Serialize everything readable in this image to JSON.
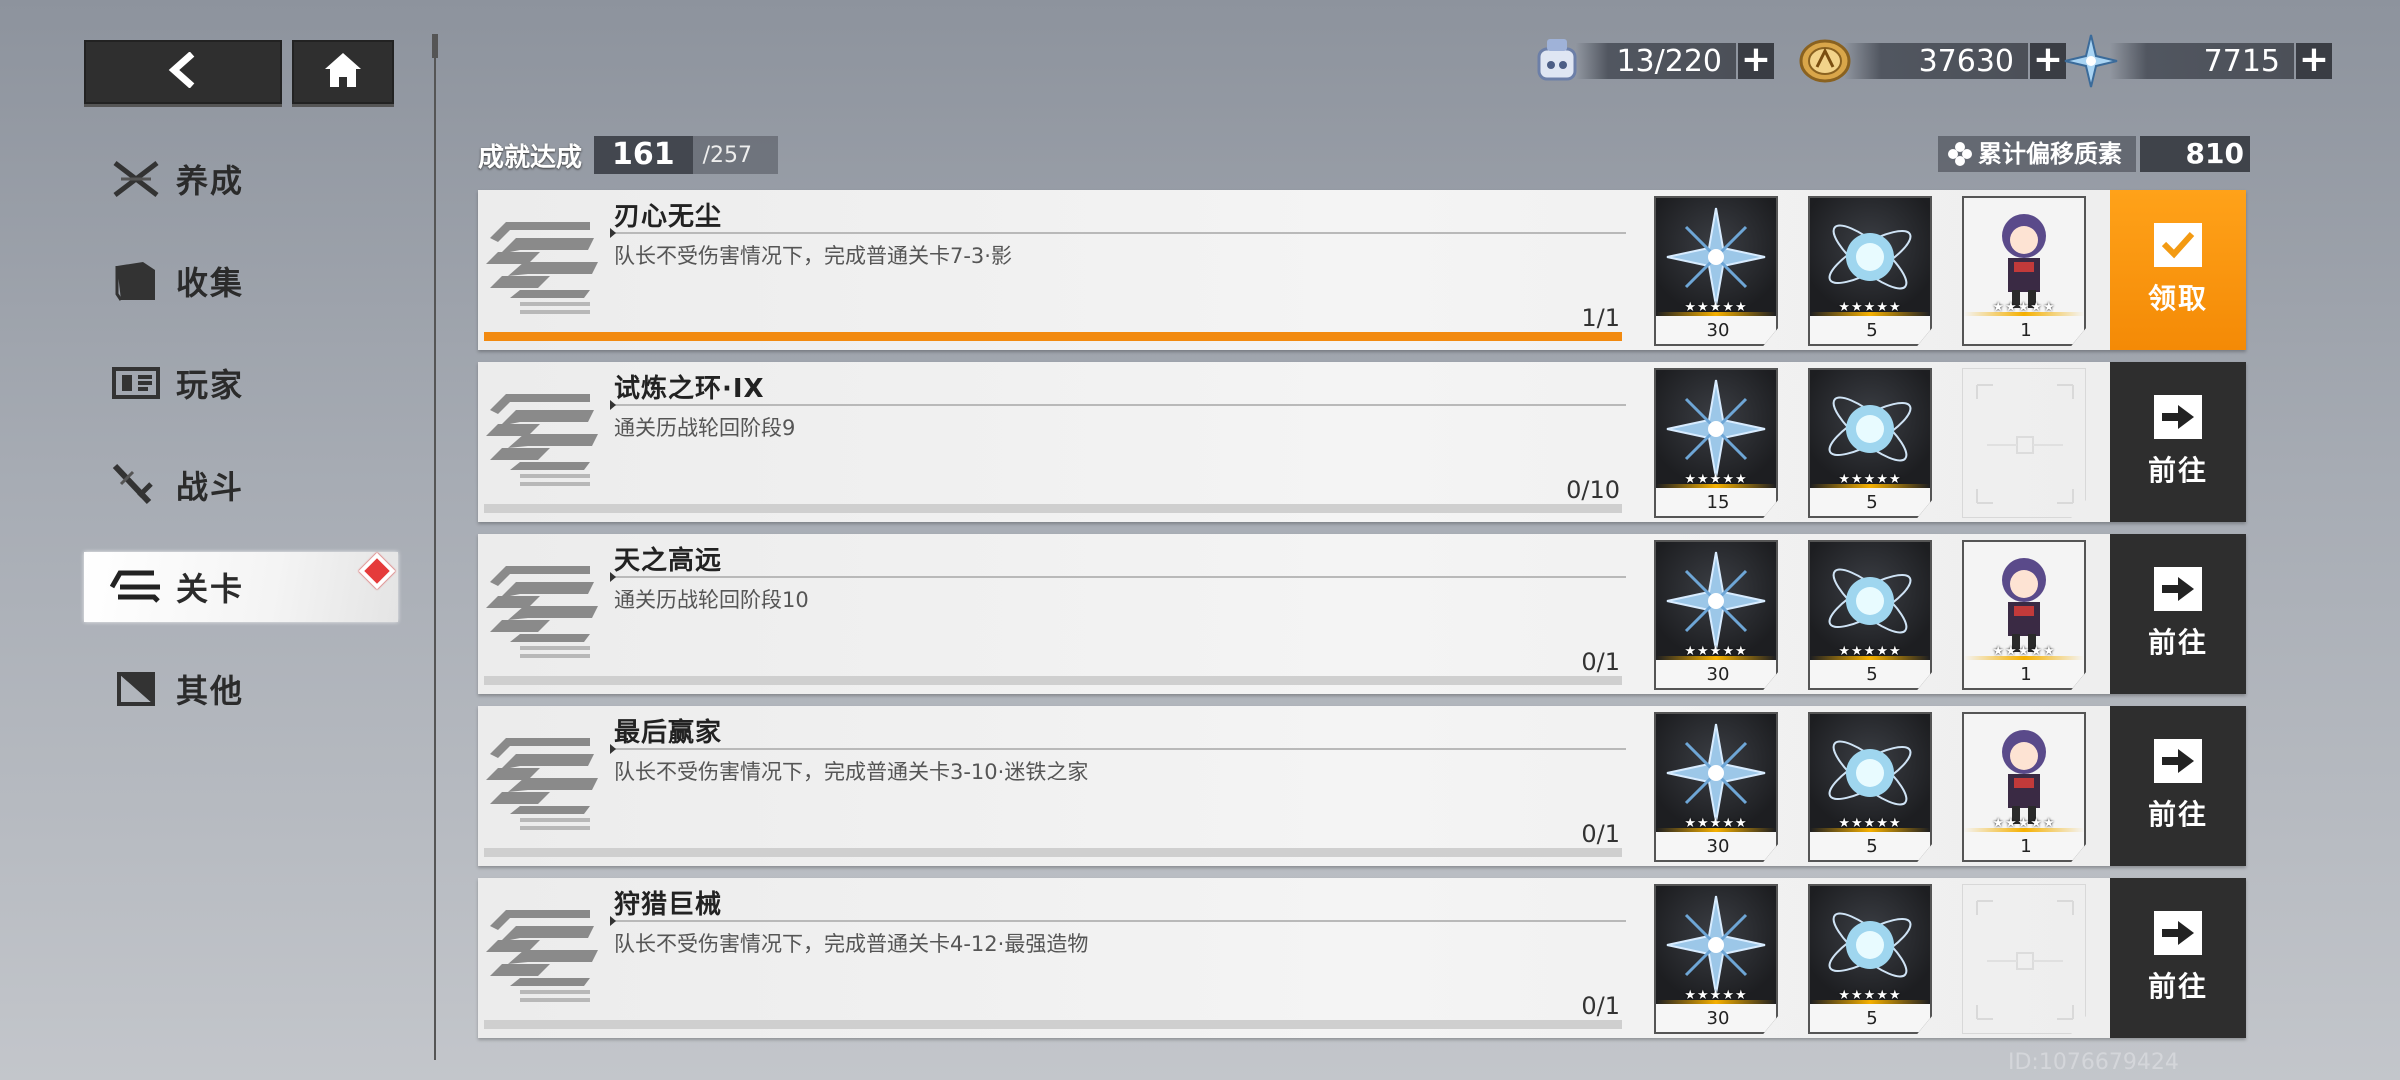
{
  "nav": {
    "back_icon": "back-arrow-icon",
    "home_icon": "home-icon"
  },
  "sidebar": {
    "items": [
      {
        "label": "养成",
        "icon": "crossed-swords-icon"
      },
      {
        "label": "收集",
        "icon": "folder-icon"
      },
      {
        "label": "玩家",
        "icon": "id-card-icon"
      },
      {
        "label": "战斗",
        "icon": "sword-icon"
      },
      {
        "label": "关卡",
        "icon": "stage-icon",
        "active": true,
        "badge": "red-diamond"
      },
      {
        "label": "其他",
        "icon": "square-icon"
      }
    ]
  },
  "resources": [
    {
      "icon": "stamina-icon",
      "value": "13/220"
    },
    {
      "icon": "coin-icon",
      "value": "37630"
    },
    {
      "icon": "crystal-icon",
      "value": "7715"
    }
  ],
  "achievement": {
    "label": "成就达成",
    "count": "161",
    "total": "/257"
  },
  "offset": {
    "label": "累计偏移质素",
    "value": "810"
  },
  "rows": [
    {
      "title": "刃心无尘",
      "desc": "队长不受伤害情况下，完成普通关卡7-3·影",
      "progress": "1/1",
      "fill": 1.0,
      "rewards": [
        {
          "type": "crystal",
          "stars": "★★★★★",
          "qty": "30"
        },
        {
          "type": "orb",
          "stars": "★★★★★",
          "qty": "5"
        },
        {
          "type": "character",
          "stars": "★★★★★",
          "qty": "1"
        }
      ],
      "action": "领取",
      "action_type": "claim"
    },
    {
      "title": "试炼之环·IX",
      "desc": "通关历战轮回阶段9",
      "progress": "0/10",
      "fill": 0.0,
      "rewards": [
        {
          "type": "crystal",
          "stars": "★★★★★",
          "qty": "15"
        },
        {
          "type": "orb",
          "stars": "★★★★★",
          "qty": "5"
        },
        {
          "type": "empty"
        }
      ],
      "action": "前往",
      "action_type": "go"
    },
    {
      "title": "天之高远",
      "desc": "通关历战轮回阶段10",
      "progress": "0/1",
      "fill": 0.0,
      "rewards": [
        {
          "type": "crystal",
          "stars": "★★★★★",
          "qty": "30"
        },
        {
          "type": "orb",
          "stars": "★★★★★",
          "qty": "5"
        },
        {
          "type": "character",
          "stars": "★★★★★",
          "qty": "1"
        }
      ],
      "action": "前往",
      "action_type": "go"
    },
    {
      "title": "最后赢家",
      "desc": "队长不受伤害情况下，完成普通关卡3-10·迷铁之家",
      "progress": "0/1",
      "fill": 0.0,
      "rewards": [
        {
          "type": "crystal",
          "stars": "★★★★★",
          "qty": "30"
        },
        {
          "type": "orb",
          "stars": "★★★★★",
          "qty": "5"
        },
        {
          "type": "character",
          "stars": "★★★★★",
          "qty": "1"
        }
      ],
      "action": "前往",
      "action_type": "go"
    },
    {
      "title": "狩猎巨械",
      "desc": "队长不受伤害情况下，完成普通关卡4-12·最强造物",
      "progress": "0/1",
      "fill": 0.0,
      "rewards": [
        {
          "type": "crystal",
          "stars": "★★★★★",
          "qty": "30"
        },
        {
          "type": "orb",
          "stars": "★★★★★",
          "qty": "5"
        },
        {
          "type": "empty"
        }
      ],
      "action": "前往",
      "action_type": "go"
    }
  ],
  "user_id": "ID:1076679424",
  "colors": {
    "accent": "#f28a10",
    "dark_button": "#2e2e2e",
    "badge": "#e53b3b"
  }
}
